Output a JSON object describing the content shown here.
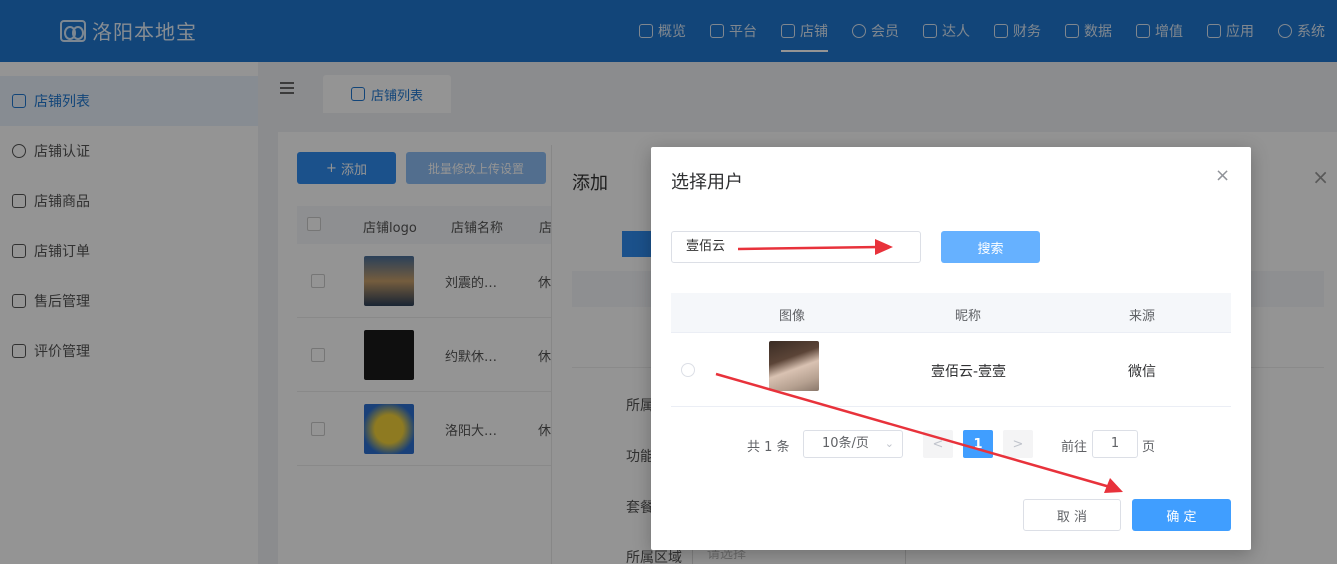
{
  "app": {
    "name": "洛阳本地宝"
  },
  "nav": [
    {
      "label": "概览",
      "icon": "dashboard-icon",
      "active": false
    },
    {
      "label": "平台",
      "icon": "monitor-icon",
      "active": false
    },
    {
      "label": "店铺",
      "icon": "store-icon",
      "active": true
    },
    {
      "label": "会员",
      "icon": "user-icon",
      "active": false
    },
    {
      "label": "达人",
      "icon": "yen-badge-icon",
      "active": false
    },
    {
      "label": "财务",
      "icon": "yen-box-icon",
      "active": false
    },
    {
      "label": "数据",
      "icon": "line-chart-icon",
      "active": false
    },
    {
      "label": "增值",
      "icon": "bar-chart-icon",
      "active": false
    },
    {
      "label": "应用",
      "icon": "cube-icon",
      "active": false
    },
    {
      "label": "系统",
      "icon": "gear-icon",
      "active": false
    }
  ],
  "sidebar": [
    {
      "label": "店铺列表",
      "icon": "store-icon",
      "active": true
    },
    {
      "label": "店铺认证",
      "icon": "verify-icon",
      "active": false
    },
    {
      "label": "店铺商品",
      "icon": "cube-icon",
      "active": false
    },
    {
      "label": "店铺订单",
      "icon": "clipboard-icon",
      "active": false
    },
    {
      "label": "售后管理",
      "icon": "after-sales-icon",
      "active": false
    },
    {
      "label": "评价管理",
      "icon": "comment-icon",
      "active": false
    }
  ],
  "tab": {
    "label": "店铺列表"
  },
  "toolbar": {
    "add_label": "添加",
    "batch_label": "批量修改上传设置"
  },
  "store_table": {
    "headers": [
      "店铺logo",
      "店铺名称",
      "店"
    ],
    "rows": [
      {
        "name": "刘震的…",
        "extra": "休"
      },
      {
        "name": "约默休…",
        "extra": "休"
      },
      {
        "name": "洛阳大…",
        "extra": "休"
      }
    ]
  },
  "drawer": {
    "title": "添加",
    "labels": [
      "所属",
      "功能",
      "套餐",
      "所属区域"
    ],
    "region_placeholder": "请选择"
  },
  "modal": {
    "title": "选择用户",
    "search_value": "壹佰云",
    "search_button": "搜索",
    "headers": [
      "图像",
      "昵称",
      "来源"
    ],
    "rows": [
      {
        "nickname": "壹佰云-壹壹",
        "source": "微信"
      }
    ],
    "pagination": {
      "total": "共 1 条",
      "page_size": "10条/页",
      "current_page": "1",
      "goto_label": "前往",
      "goto_value": "1",
      "page_suffix": "页"
    },
    "cancel_label": "取 消",
    "confirm_label": "确 定"
  },
  "colors": {
    "primary": "#1f78d1",
    "button": "#409eff",
    "annotation_arrow": "#e8323b"
  }
}
